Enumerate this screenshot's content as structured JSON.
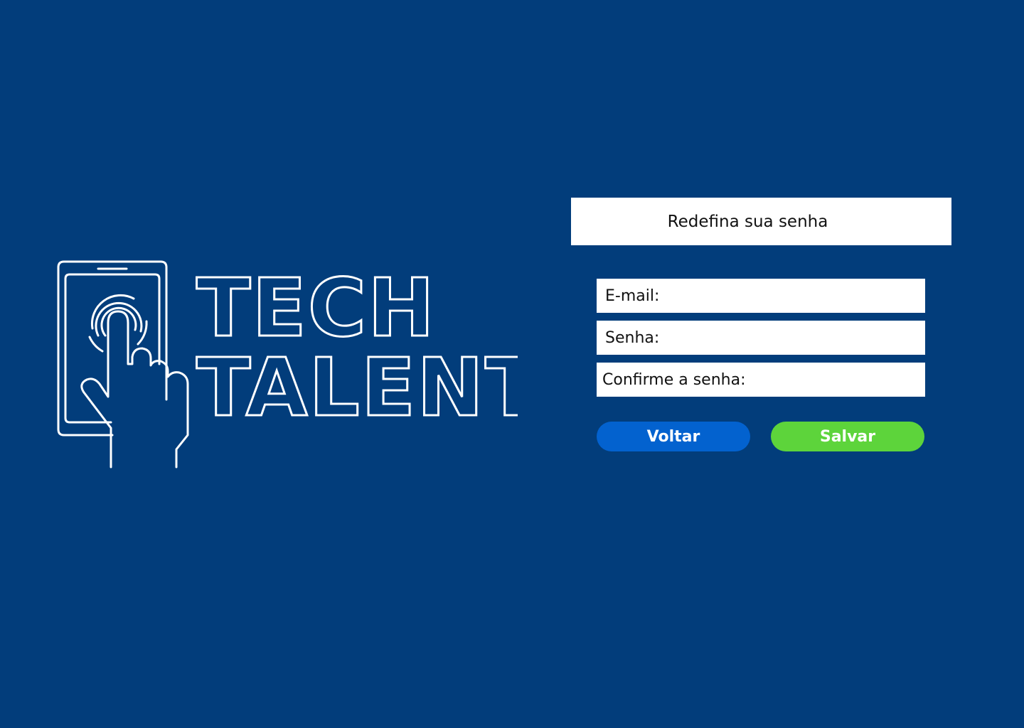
{
  "brand": {
    "logo_line1": "TECH",
    "logo_line2": "TALENT"
  },
  "form": {
    "title": "Redefina sua senha",
    "fields": [
      {
        "label": "E-mail:",
        "value": ""
      },
      {
        "label": "Senha:",
        "value": ""
      },
      {
        "label": "Confirme a senha:",
        "value": ""
      }
    ],
    "back_label": "Voltar",
    "save_label": "Salvar"
  },
  "icons": {
    "logo_icon": "tablet-touch-icon"
  },
  "colors": {
    "background": "#023d7b",
    "back_button": "#0362cf",
    "save_button": "#5dd43b",
    "panel": "#ffffff"
  }
}
